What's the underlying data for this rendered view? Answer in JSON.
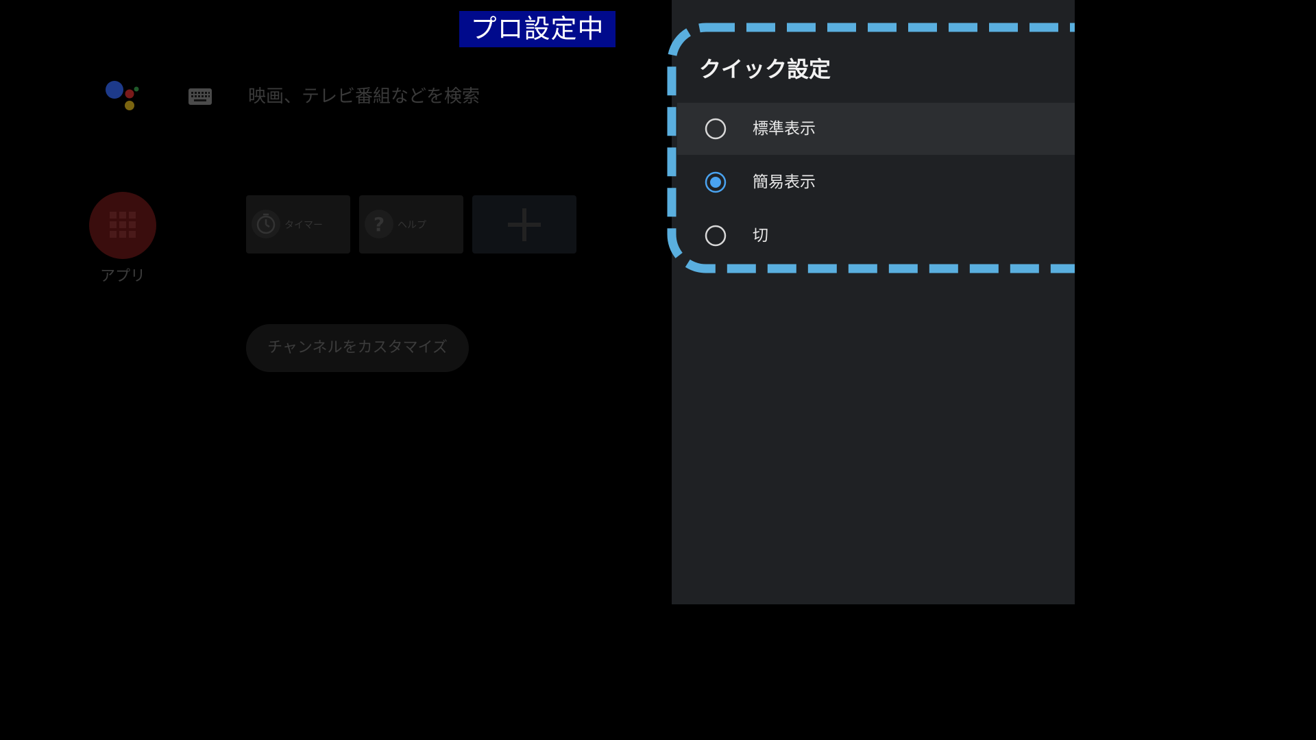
{
  "status_badge": {
    "text": "プロ設定中",
    "background": "#000a8c"
  },
  "home": {
    "assistant_icon": "google-assistant-icon",
    "keyboard_icon": "keyboard-icon",
    "search_placeholder": "映画、テレビ番組などを検索",
    "apps": {
      "label": "アプリ",
      "icon": "apps-grid-icon"
    },
    "tiles": [
      {
        "label": "タイマー",
        "icon": "timer-icon"
      },
      {
        "label": "ヘルプ",
        "icon": "help-icon"
      },
      {
        "label": "",
        "icon": "plus-icon"
      }
    ],
    "customize_channels": "チャンネルをカスタマイズ"
  },
  "quick_settings": {
    "title": "クイック設定",
    "options": [
      {
        "label": "標準表示",
        "selected": false,
        "focused": true
      },
      {
        "label": "簡易表示",
        "selected": true,
        "focused": false
      },
      {
        "label": "切",
        "selected": false,
        "focused": false
      }
    ],
    "accent_color": "#4aa3f0",
    "highlight_frame_color": "#5aafdf"
  }
}
